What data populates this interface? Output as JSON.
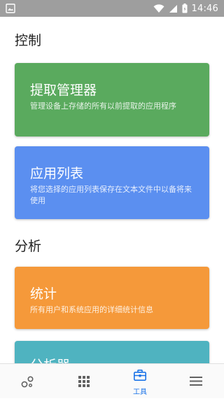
{
  "status_bar": {
    "time": "14:46",
    "icons": [
      "gallery-icon",
      "wifi-icon",
      "signal-icon",
      "battery-icon"
    ]
  },
  "sections": {
    "control": {
      "title": "控制"
    },
    "analysis": {
      "title": "分析"
    }
  },
  "cards": [
    {
      "title": "提取管理器",
      "desc": "管理设备上存储的所有以前提取的应用程序",
      "color": "#5aaa5e"
    },
    {
      "title": "应用列表",
      "desc": "将您选择的应用列表保存在文本文件中以备将来使用",
      "color": "#5b8ff0"
    },
    {
      "title": "统计",
      "desc": "所有用户和系统应用的详细统计信息",
      "color": "#f5993a"
    },
    {
      "title": "分析器",
      "desc": "",
      "color": "#4fb3c0"
    }
  ],
  "bottom_nav": {
    "items": [
      {
        "icon": "bubbles-icon",
        "label": ""
      },
      {
        "icon": "apps-grid-icon",
        "label": ""
      },
      {
        "icon": "toolbox-icon",
        "label": "工具",
        "active": true
      },
      {
        "icon": "menu-icon",
        "label": ""
      }
    ],
    "active_color": "#1a73e8",
    "inactive_color": "#616161"
  }
}
